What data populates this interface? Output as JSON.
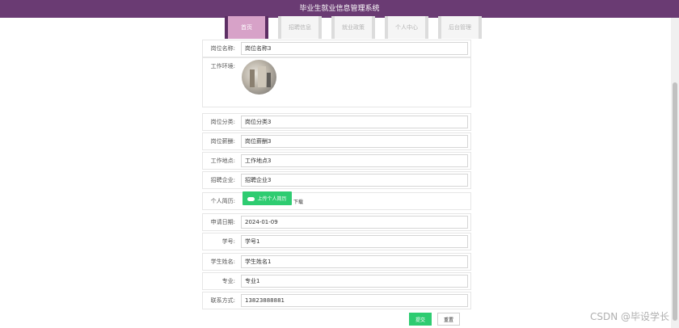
{
  "header": {
    "title": "毕业生就业信息管理系统"
  },
  "nav": {
    "tabs": [
      {
        "label": "首页",
        "active": true
      },
      {
        "label": "招聘信息",
        "active": false
      },
      {
        "label": "就业政策",
        "active": false
      },
      {
        "label": "个人中心",
        "active": false
      },
      {
        "label": "后台管理",
        "active": false
      }
    ]
  },
  "form": {
    "job_name": {
      "label": "岗位名称:",
      "value": "岗位名称3"
    },
    "work_env": {
      "label": "工作环境:"
    },
    "job_category": {
      "label": "岗位分类:",
      "value": "岗位分类3"
    },
    "job_salary": {
      "label": "岗位薪酬:",
      "value": "岗位薪酬3"
    },
    "work_location": {
      "label": "工作地点:",
      "value": "工作地点3"
    },
    "company": {
      "label": "招聘企业:",
      "value": "招聘企业3"
    },
    "resume": {
      "label": "个人简历:",
      "upload_label": "上传个人简历",
      "download_label": "下载"
    },
    "apply_date": {
      "label": "申请日期:",
      "value": "2024-01-09"
    },
    "student_id": {
      "label": "学号:",
      "value": "学号1"
    },
    "student_name": {
      "label": "学生姓名:",
      "value": "学生姓名1"
    },
    "major": {
      "label": "专业:",
      "value": "专业1"
    },
    "contact": {
      "label": "联系方式:",
      "value": "13823888881"
    }
  },
  "actions": {
    "submit_label": "提交",
    "reset_label": "重置"
  },
  "watermark": "CSDN @毕设学长",
  "colors": {
    "header": "#6a3b73",
    "accent": "#2ecc71",
    "active_tab": "#d7a2c8"
  }
}
